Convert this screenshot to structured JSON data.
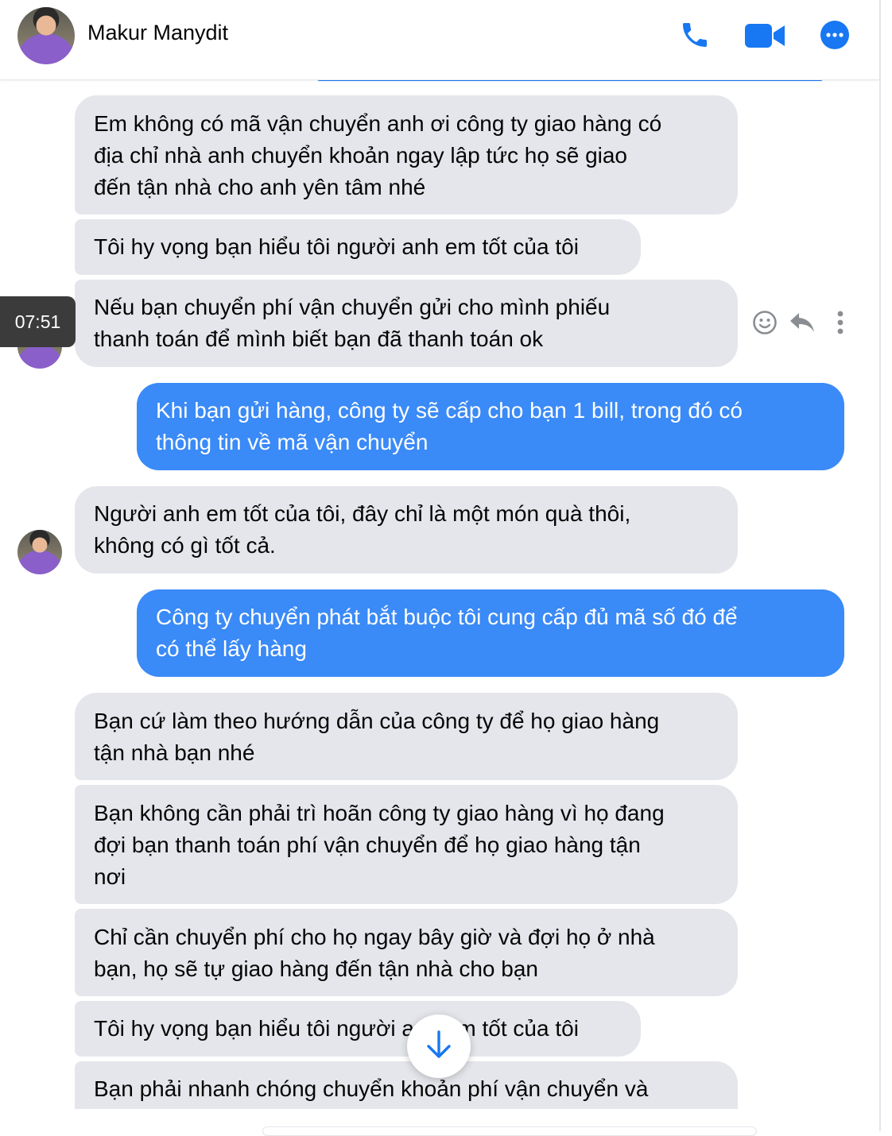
{
  "header": {
    "contact_name": "Makur Manydit",
    "icons": [
      "phone-icon",
      "video-camera-icon",
      "more-options-icon"
    ],
    "accent_color": "#1877f2"
  },
  "tooltip": {
    "time": "07:51"
  },
  "message_actions": [
    "emoji-reaction-icon",
    "reply-icon",
    "more-vertical-icon"
  ],
  "messages": [
    {
      "side": "incoming",
      "text": "Em không có mã vận chuyển anh ơi công ty giao hàng có\nđịa chỉ nhà anh chuyển khoản ngay lập tức họ sẽ giao\nđến tận nhà cho anh yên tâm nhé"
    },
    {
      "side": "incoming",
      "text": "Tôi hy vọng bạn hiểu tôi người anh em tốt của tôi"
    },
    {
      "side": "incoming",
      "text": "Nếu bạn chuyển phí vận chuyển gửi cho mình phiếu\nthanh toán để mình biết bạn đã thanh toán ok"
    },
    {
      "side": "outgoing",
      "text": "Khi bạn gửi hàng, công ty sẽ cấp cho bạn 1 bill, trong đó có\nthông tin về mã vận chuyển"
    },
    {
      "side": "incoming",
      "text": "Người anh em tốt của tôi, đây chỉ là một món quà thôi,\nkhông có gì tốt cả."
    },
    {
      "side": "outgoing",
      "text": "Công ty chuyển phát bắt buộc tôi cung cấp đủ mã số đó để\ncó thể lấy hàng"
    },
    {
      "side": "incoming",
      "text": "Bạn cứ làm theo hướng dẫn của công ty để họ giao hàng\ntận nhà bạn nhé"
    },
    {
      "side": "incoming",
      "text": "Bạn không cần phải trì hoãn công ty giao hàng vì họ đang\nđợi bạn thanh toán phí vận chuyển để họ giao hàng tận\nnơi"
    },
    {
      "side": "incoming",
      "text": "Chỉ cần chuyển phí cho họ ngay bây giờ và đợi họ ở nhà\nbạn, họ sẽ tự giao hàng đến tận nhà cho bạn"
    },
    {
      "side": "incoming",
      "text": "Tôi hy vọng bạn hiểu tôi người anh em tốt của tôi"
    },
    {
      "side": "incoming",
      "text": "Bạn phải nhanh chóng chuyển khoản phí vận chuyển và"
    }
  ],
  "colors": {
    "incoming_bubble": "#e4e6eb",
    "outgoing_bubble": "#3a8af7",
    "icon_gray": "#8a8d91"
  },
  "scroll_down_icon": "arrow-down-icon"
}
